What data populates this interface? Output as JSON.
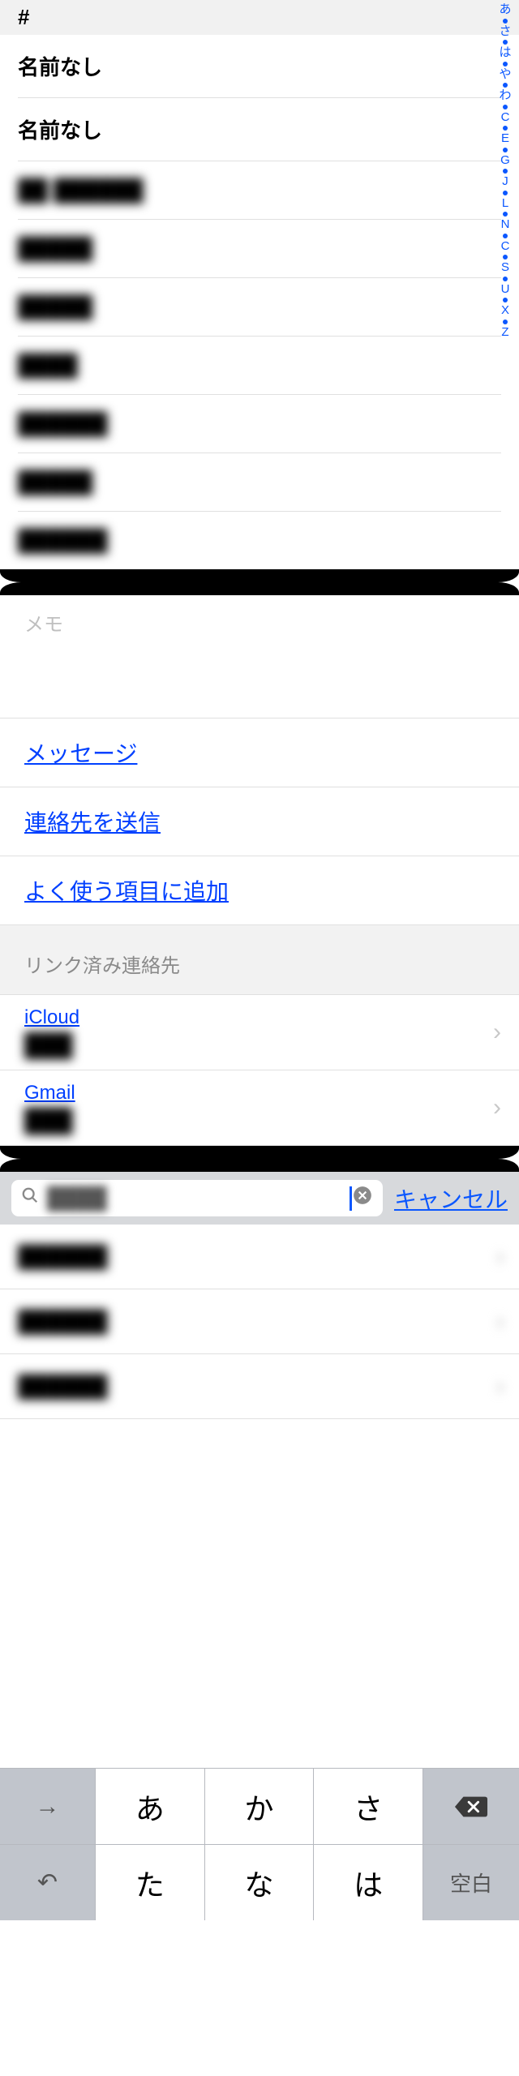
{
  "contacts_panel": {
    "section_hash": "#",
    "rows": [
      "名前なし",
      "名前なし",
      "██ ██████",
      "█████",
      "█████",
      "████",
      "██████",
      "█████",
      "██████"
    ],
    "index": [
      "あ",
      "●",
      "さ",
      "●",
      "は",
      "●",
      "や",
      "●",
      "わ",
      "●",
      "C",
      "●",
      "E",
      "●",
      "G",
      "●",
      "J",
      "●",
      "L",
      "●",
      "N",
      "●",
      "C",
      "●",
      "S",
      "●",
      "U",
      "●",
      "X",
      "●",
      "Z"
    ]
  },
  "detail_panel": {
    "memo_label": "メモ",
    "action_message": "メッセージ",
    "action_send_contact": "連絡先を送信",
    "action_add_favorite": "よく使う項目に追加",
    "linked_header": "リンク済み連絡先",
    "linked": [
      {
        "source": "iCloud",
        "name": "███"
      },
      {
        "source": "Gmail",
        "name": "███"
      }
    ]
  },
  "search_panel": {
    "query_display": "████",
    "cancel": "キャンセル",
    "results": [
      "██████",
      "██████",
      "██████"
    ]
  },
  "keyboard": {
    "row1": {
      "tab": "→",
      "k1": "あ",
      "k2": "か",
      "k3": "さ"
    },
    "row2": {
      "undo": "↶",
      "k1": "た",
      "k2": "な",
      "k3": "は",
      "space": "空白"
    }
  }
}
